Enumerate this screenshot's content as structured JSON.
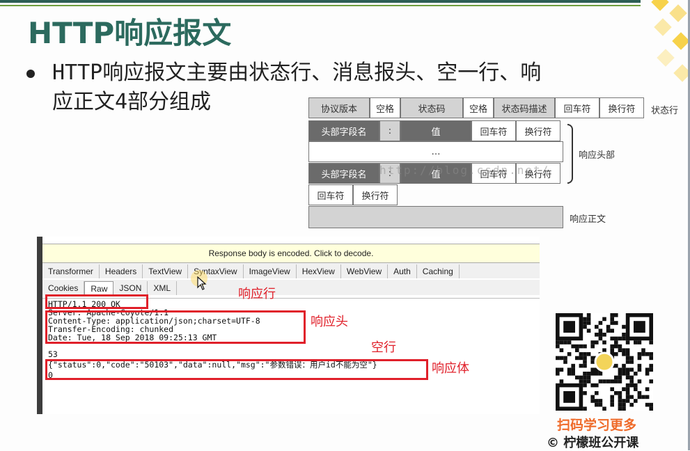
{
  "slide": {
    "title": "HTTP响应报文",
    "bullet_line1": "HTTP响应报文主要由状态行、消息报头、空一行、响",
    "bullet_line2": "应正文4部分组成"
  },
  "diagram": {
    "status_line": [
      "协议版本",
      "空格",
      "状态码",
      "空格",
      "状态码描述",
      "回车符",
      "换行符"
    ],
    "status_line_label": "状态行",
    "header_row": [
      "头部字段名",
      ":",
      "值",
      "回车符",
      "换行符"
    ],
    "ellipsis": "…",
    "header_label": "响应头部",
    "blank_row": [
      "回车符",
      "换行符"
    ],
    "body_label": "响应正文",
    "watermark": "http://blog.csdn.net/"
  },
  "fiddler": {
    "banner": "Response body is encoded. Click to decode.",
    "tabs_row1": [
      "Transformer",
      "Headers",
      "TextView",
      "SyntaxView",
      "ImageView",
      "HexView",
      "WebView",
      "Auth",
      "Caching"
    ],
    "tabs_row2": [
      "Cookies",
      "Raw",
      "JSON",
      "XML"
    ],
    "active_tab": "Raw",
    "response_lines": [
      "HTTP/1.1 200 OK",
      "Server: Apache-Coyote/1.1",
      "Content-Type: application/json;charset=UTF-8",
      "Transfer-Encoding: chunked",
      "Date: Tue, 18 Sep 2018 09:25:13 GMT",
      "",
      "53",
      "{\"status\":0,\"code\":\"50103\",\"data\":null,\"msg\":\"参数错误：用户id不能为空\"}",
      "0"
    ],
    "annotations": {
      "status_line": "响应行",
      "headers": "响应头",
      "blank_line": "空行",
      "body": "响应体"
    },
    "colors": {
      "annotation": "#e0202a",
      "banner": "#ffffdc"
    }
  },
  "qr": {
    "caption": "扫码学习更多",
    "copyright": "© 柠檬班公开课"
  }
}
